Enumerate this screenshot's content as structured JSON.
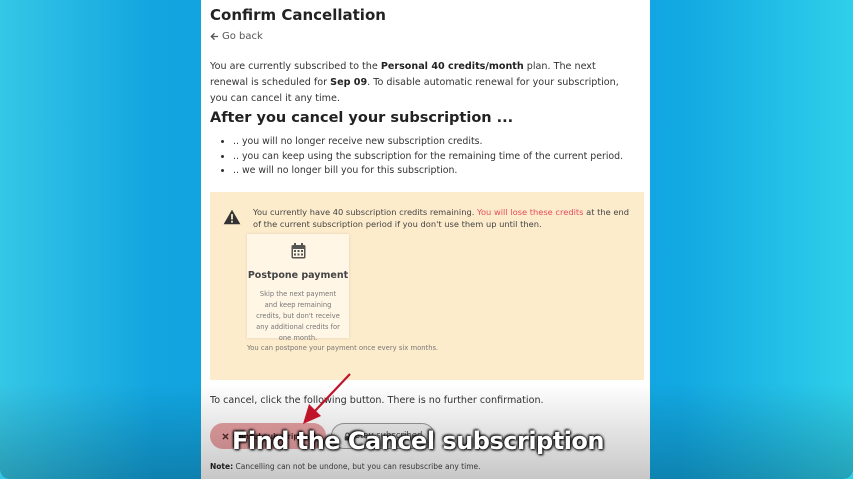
{
  "page": {
    "title": "Confirm Cancellation",
    "go_back": "Go back",
    "intro": {
      "part1": "You are currently subscribed to the ",
      "plan": "Personal 40 credits/month",
      "part2": " plan. The next renewal is scheduled for ",
      "date": "Sep 09",
      "part3": ". To disable automatic renewal for your subscription, you can cancel it any time."
    },
    "after_heading": "After you cancel your subscription ...",
    "bullets": [
      ".. you will no longer receive new subscription credits.",
      ".. you can keep using the subscription for the remaining time of the current period.",
      ".. we will no longer bill you for this subscription."
    ],
    "warning": {
      "part1": "You currently have 40 subscription credits remaining. ",
      "highlight": "You will lose these credits",
      "part2": " at the end of the current subscription period if you don't use them up until then."
    },
    "postpone": {
      "title": "Postpone payment",
      "description": "Skip the next payment and keep remaining credits, but don't receive any additional credits for one month.",
      "note": "You can postpone your payment once every six months."
    },
    "to_cancel": "To cancel, click the following button. There is no further confirmation.",
    "cancel_button": "Cancel subscription",
    "stay_button": "Stay subscribed",
    "note_label": "Note:",
    "note_text": " Cancelling can not be undone, but you can resubscribe any time."
  },
  "overlay": {
    "caption": "Find the Cancel subscription"
  },
  "colors": {
    "warning_bg": "#fdeccc",
    "highlight_red": "#e84a5f",
    "cancel_btn": "#e9a2a4",
    "arrow": "#c0142a"
  },
  "icons": {
    "back": "arrow-left-icon",
    "warning": "warning-triangle-icon",
    "calendar": "calendar-icon",
    "cancel": "x-icon",
    "stay": "lock-icon"
  }
}
